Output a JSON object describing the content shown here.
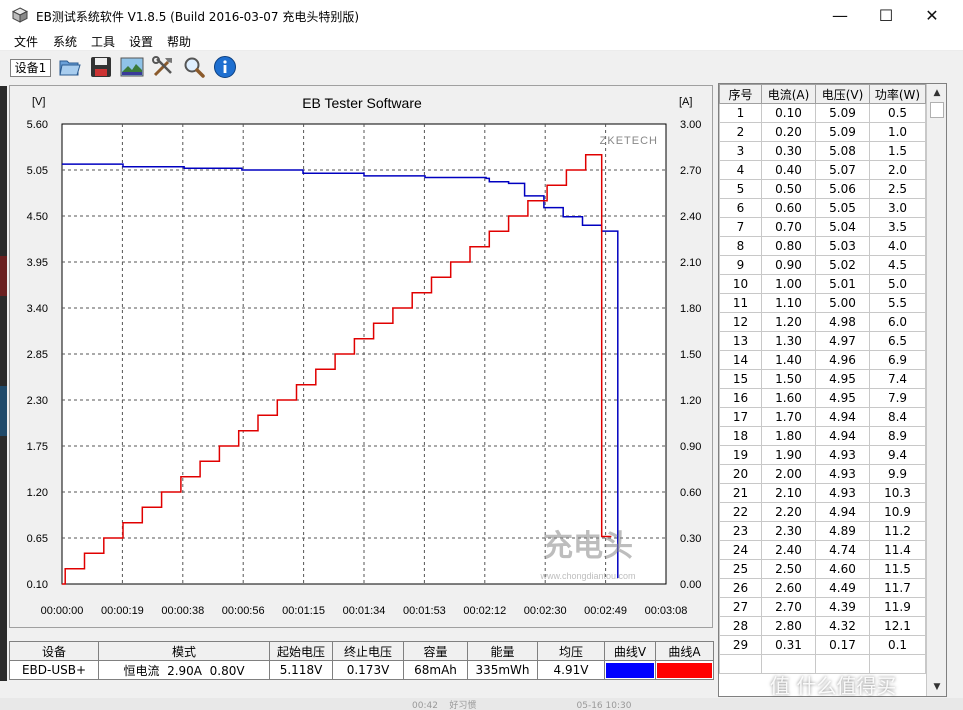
{
  "window": {
    "title": "EB测试系统软件 V1.8.5 (Build 2016-03-07 充电头特别版)",
    "controls": {
      "minimize": "—",
      "maximize": "☐",
      "close": "✕"
    }
  },
  "menu": [
    "文件",
    "系统",
    "工具",
    "设置",
    "帮助"
  ],
  "toolbar": {
    "device_tab": "设备1",
    "icons": [
      "open-folder-icon",
      "save-icon",
      "chart-image-icon",
      "tools-icon",
      "search-icon",
      "info-icon"
    ]
  },
  "chart_data": {
    "type": "line",
    "title": "EB Tester Software",
    "watermark": "ZKETECH",
    "left_unit": "[V]",
    "right_unit": "[A]",
    "x_ticks": [
      "00:00:00",
      "00:00:19",
      "00:00:38",
      "00:00:56",
      "00:01:15",
      "00:01:34",
      "00:01:53",
      "00:02:12",
      "00:02:30",
      "00:02:49",
      "00:03:08"
    ],
    "y_left_ticks": [
      "5.60",
      "5.05",
      "4.50",
      "3.95",
      "3.40",
      "2.85",
      "2.30",
      "1.75",
      "1.20",
      "0.65",
      "0.10"
    ],
    "y_right_ticks": [
      "3.00",
      "2.70",
      "2.40",
      "2.10",
      "1.80",
      "1.50",
      "1.20",
      "0.90",
      "0.60",
      "0.30",
      "0.00"
    ],
    "ylim_left": [
      0.1,
      5.6
    ],
    "ylim_right": [
      0.0,
      3.0
    ],
    "xlim_seconds": [
      0,
      188
    ],
    "grid": true,
    "series": [
      {
        "name": "曲线V",
        "axis": "left",
        "color": "#0000c0",
        "points": [
          [
            0,
            5.12
          ],
          [
            19,
            5.09
          ],
          [
            38,
            5.07
          ],
          [
            56,
            5.05
          ],
          [
            75,
            5.01
          ],
          [
            94,
            4.98
          ],
          [
            113,
            4.96
          ],
          [
            132,
            4.95
          ],
          [
            133,
            4.91
          ],
          [
            139,
            4.89
          ],
          [
            144,
            4.74
          ],
          [
            150,
            4.6
          ],
          [
            156,
            4.49
          ],
          [
            162,
            4.39
          ],
          [
            168,
            4.32
          ],
          [
            173,
            4.32
          ],
          [
            173,
            0.17
          ]
        ]
      },
      {
        "name": "曲线A",
        "axis": "right",
        "color": "#e00000",
        "points": [
          [
            0,
            0.0
          ],
          [
            1,
            0.1
          ],
          [
            7,
            0.2
          ],
          [
            13,
            0.3
          ],
          [
            19,
            0.4
          ],
          [
            25,
            0.5
          ],
          [
            31,
            0.6
          ],
          [
            37,
            0.7
          ],
          [
            43,
            0.8
          ],
          [
            49,
            0.9
          ],
          [
            55,
            1.0
          ],
          [
            61,
            1.1
          ],
          [
            67,
            1.2
          ],
          [
            73,
            1.3
          ],
          [
            79,
            1.4
          ],
          [
            85,
            1.5
          ],
          [
            91,
            1.6
          ],
          [
            97,
            1.7
          ],
          [
            103,
            1.8
          ],
          [
            109,
            1.9
          ],
          [
            115,
            2.0
          ],
          [
            121,
            2.1
          ],
          [
            127,
            2.2
          ],
          [
            133,
            2.3
          ],
          [
            139,
            2.4
          ],
          [
            145,
            2.5
          ],
          [
            151,
            2.6
          ],
          [
            157,
            2.7
          ],
          [
            163,
            2.8
          ],
          [
            168,
            2.8
          ],
          [
            168,
            0.31
          ],
          [
            171,
            0.31
          ]
        ]
      }
    ]
  },
  "data_table": {
    "headers": [
      "序号",
      "电流(A)",
      "电压(V)",
      "功率(W)"
    ],
    "rows": [
      [
        "1",
        "0.10",
        "5.09",
        "0.5"
      ],
      [
        "2",
        "0.20",
        "5.09",
        "1.0"
      ],
      [
        "3",
        "0.30",
        "5.08",
        "1.5"
      ],
      [
        "4",
        "0.40",
        "5.07",
        "2.0"
      ],
      [
        "5",
        "0.50",
        "5.06",
        "2.5"
      ],
      [
        "6",
        "0.60",
        "5.05",
        "3.0"
      ],
      [
        "7",
        "0.70",
        "5.04",
        "3.5"
      ],
      [
        "8",
        "0.80",
        "5.03",
        "4.0"
      ],
      [
        "9",
        "0.90",
        "5.02",
        "4.5"
      ],
      [
        "10",
        "1.00",
        "5.01",
        "5.0"
      ],
      [
        "11",
        "1.10",
        "5.00",
        "5.5"
      ],
      [
        "12",
        "1.20",
        "4.98",
        "6.0"
      ],
      [
        "13",
        "1.30",
        "4.97",
        "6.5"
      ],
      [
        "14",
        "1.40",
        "4.96",
        "6.9"
      ],
      [
        "15",
        "1.50",
        "4.95",
        "7.4"
      ],
      [
        "16",
        "1.60",
        "4.95",
        "7.9"
      ],
      [
        "17",
        "1.70",
        "4.94",
        "8.4"
      ],
      [
        "18",
        "1.80",
        "4.94",
        "8.9"
      ],
      [
        "19",
        "1.90",
        "4.93",
        "9.4"
      ],
      [
        "20",
        "2.00",
        "4.93",
        "9.9"
      ],
      [
        "21",
        "2.10",
        "4.93",
        "10.3"
      ],
      [
        "22",
        "2.20",
        "4.94",
        "10.9"
      ],
      [
        "23",
        "2.30",
        "4.89",
        "11.2"
      ],
      [
        "24",
        "2.40",
        "4.74",
        "11.4"
      ],
      [
        "25",
        "2.50",
        "4.60",
        "11.5"
      ],
      [
        "26",
        "2.60",
        "4.49",
        "11.7"
      ],
      [
        "27",
        "2.70",
        "4.39",
        "11.9"
      ],
      [
        "28",
        "2.80",
        "4.32",
        "12.1"
      ],
      [
        "29",
        "0.31",
        "0.17",
        "0.1"
      ]
    ]
  },
  "summary": {
    "headers": [
      "设备",
      "模式",
      "起始电压",
      "终止电压",
      "容量",
      "能量",
      "均压",
      "曲线V",
      "曲线A"
    ],
    "row": [
      "EBD-USB+",
      "恒电流  2.90A  0.80V",
      "5.118V",
      "0.173V",
      "68mAh",
      "335mWh",
      "4.91V"
    ],
    "curve_v_color": "#0000ff",
    "curve_a_color": "#ff0000"
  },
  "footer_text": "00:42    好习惯                                   05-16 10:30"
}
